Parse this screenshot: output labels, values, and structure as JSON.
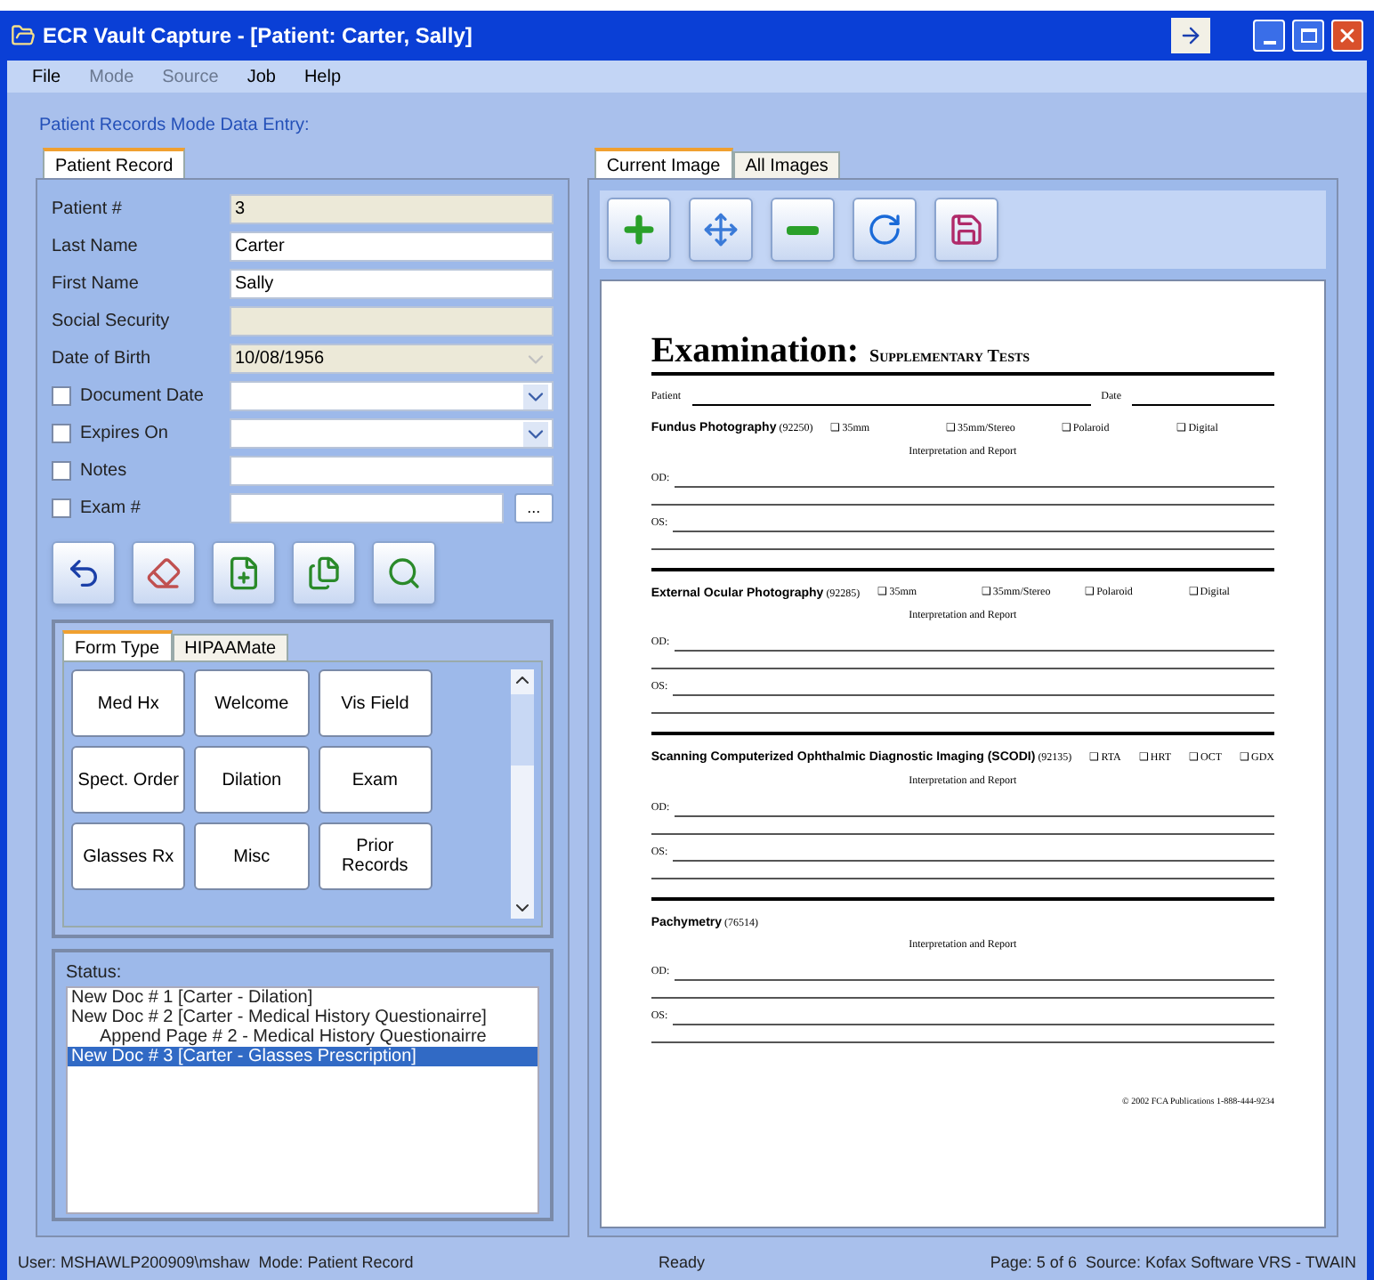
{
  "window": {
    "title": "ECR Vault Capture - [Patient: Carter, Sally]"
  },
  "menu": [
    {
      "label": "File",
      "disabled": false
    },
    {
      "label": "Mode",
      "disabled": true
    },
    {
      "label": "Source",
      "disabled": true
    },
    {
      "label": "Job",
      "disabled": false
    },
    {
      "label": "Help",
      "disabled": false
    }
  ],
  "group_title": "Patient Records Mode Data Entry:",
  "left_tabs": [
    {
      "label": "Patient Record",
      "selected": true
    }
  ],
  "fields": [
    {
      "label": "Patient #",
      "value": "3",
      "kind": "text",
      "readonly": true
    },
    {
      "label": "Last Name",
      "value": "Carter",
      "kind": "text",
      "readonly": false
    },
    {
      "label": "First Name",
      "value": "Sally",
      "kind": "text",
      "readonly": false
    },
    {
      "label": "Social Security",
      "kind": "text",
      "readonly": true
    },
    {
      "label": "Date of Birth",
      "value": "10/08/1956",
      "kind": "dropdown",
      "readonly": true
    },
    {
      "label": "Document Date",
      "kind": "dropdown",
      "readonly": false,
      "checked": false
    },
    {
      "label": "Expires On",
      "kind": "dropdown",
      "readonly": false,
      "checked": false
    },
    {
      "label": "Notes",
      "kind": "text",
      "readonly": false,
      "checked": false
    },
    {
      "label": "Exam #",
      "kind": "browse",
      "readonly": false,
      "checked": false,
      "button": "..."
    }
  ],
  "form_tabs": [
    {
      "label": "Form Type",
      "selected": true
    },
    {
      "label": "HIPAAMate",
      "selected": false
    }
  ],
  "form_buttons": [
    "Med Hx",
    "Welcome",
    "Vis Field",
    "Spect. Order",
    "Dilation",
    "Exam",
    "Glasses Rx",
    "Misc",
    "Prior Records"
  ],
  "status": {
    "label": "Status:",
    "items": [
      {
        "text": "New Doc # 1 [Carter - Dilation]",
        "selected": false
      },
      {
        "text": "New Doc # 2 [Carter - Medical History Questionairre]",
        "selected": false,
        "children": [
          {
            "text": "Append Page # 2 - Medical History Questionairre",
            "selected": false
          }
        ]
      },
      {
        "text": "New Doc # 3 [Carter - Glasses Prescription]",
        "selected": true
      }
    ]
  },
  "right_tabs": [
    {
      "label": "Current Image",
      "selected": true
    },
    {
      "label": "All Images",
      "selected": false
    }
  ],
  "document": {
    "title": "Examination:",
    "subtitle": "Supplementary Tests",
    "patient_label": "Patient",
    "date_label": "Date",
    "sections": [
      {
        "name": "Fundus Photography",
        "code": "(92250)",
        "options": [
          "❑ 35mm",
          "❑ 35mm/Stereo",
          "❑ Polaroid",
          "❑ Digital"
        ],
        "note": "Interpretation and Report",
        "lines": [
          "OD:",
          "OS:"
        ]
      },
      {
        "name": "External Ocular Photography",
        "code": "(92285)",
        "options": [
          "❑ 35mm",
          "❑ 35mm/Stereo",
          "❑ Polaroid",
          "❑ Digital"
        ],
        "note": "Interpretation and Report",
        "lines": [
          "OD:",
          "OS:"
        ]
      },
      {
        "name": "Scanning Computerized Ophthalmic Diagnostic Imaging (SCODI)",
        "code": "(92135)",
        "options": [
          "❑ RTA",
          "❑ HRT",
          "❑ OCT",
          "❑ GDX"
        ],
        "note": "Interpretation and Report",
        "lines": [
          "OD:",
          "OS:"
        ]
      },
      {
        "name": "Pachymetry",
        "code": "(76514)",
        "note": "Interpretation and Report",
        "lines": [
          "OD:",
          "OS:"
        ]
      }
    ],
    "footer": "© 2002 FCA Publications 1-888-444-9234"
  },
  "status_bar": {
    "left": "User: MSHAWLP200909\\mshaw  Mode: Patient Record",
    "center": "Ready",
    "right": "Page: 5 of 6  Source: Kofax Software VRS - TWAIN"
  }
}
